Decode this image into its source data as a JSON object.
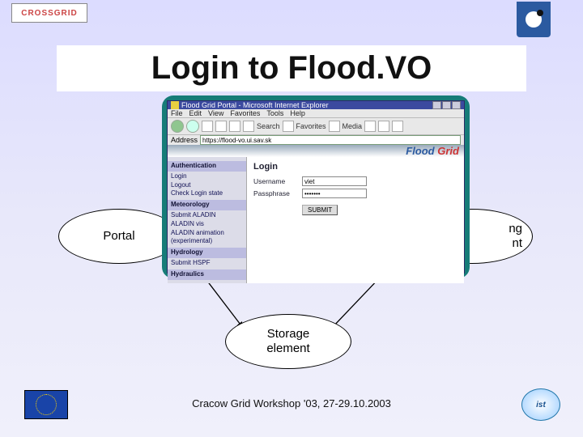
{
  "header": {
    "logo_left_text": "CROSSGRID",
    "title": "Login to Flood.VO"
  },
  "ellipses": {
    "portal": "Portal",
    "compute_line1": "Computing",
    "compute_line2": "element",
    "compute_visible_suffix1": "ng",
    "compute_visible_suffix2": "nt",
    "storage_line1": "Storage",
    "storage_line2": "element"
  },
  "browser": {
    "title": "Flood Grid Portal - Microsoft Internet Explorer",
    "menu": [
      "File",
      "Edit",
      "View",
      "Favorites",
      "Tools",
      "Help"
    ],
    "toolbar": {
      "search": "Search",
      "favorites": "Favorites",
      "media": "Media"
    },
    "address_label": "Address",
    "address_url": "https://flood-vo.ui.sav.sk",
    "banner_flood": "Flood",
    "banner_grid": "Grid",
    "sidebar": {
      "auth_hdr": "Authentication",
      "auth_items": [
        "Login",
        "Logout",
        "Check Login state"
      ],
      "met_hdr": "Meteorology",
      "met_items": [
        "Submit ALADIN",
        "ALADIN vis",
        "ALADIN animation",
        "(experimental)"
      ],
      "hyd_hdr": "Hydrology",
      "hyd_items": [
        "Submit HSPF"
      ],
      "hydra_hdr": "Hydraulics"
    },
    "form": {
      "heading": "Login",
      "user_label": "Username",
      "user_value": "viet",
      "pass_label": "Passphrase",
      "pass_value": "•••••••",
      "submit": "SUBMIT"
    }
  },
  "footer": {
    "text": "Cracow Grid Workshop '03, 27-29.10.2003",
    "ist": "ist"
  }
}
